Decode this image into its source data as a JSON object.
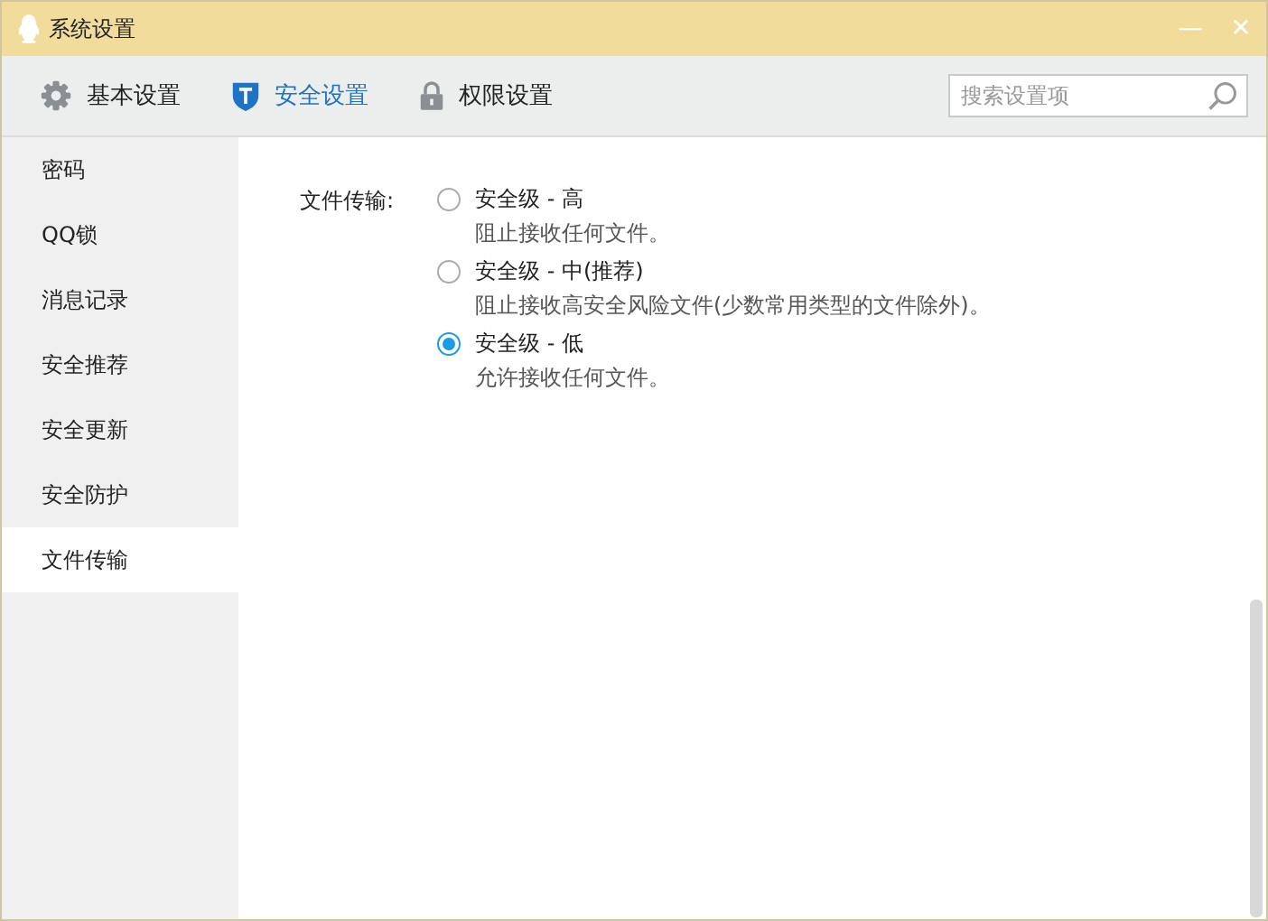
{
  "window": {
    "title": "系统设置",
    "minimize": "—",
    "close": "✕"
  },
  "tabs": [
    {
      "label": "基本设置",
      "selected": false
    },
    {
      "label": "安全设置",
      "selected": true
    },
    {
      "label": "权限设置",
      "selected": false
    }
  ],
  "search": {
    "placeholder": "搜索设置项"
  },
  "sidebar": {
    "items": [
      {
        "label": "密码",
        "selected": false
      },
      {
        "label": "QQ锁",
        "selected": false
      },
      {
        "label": "消息记录",
        "selected": false
      },
      {
        "label": "安全推荐",
        "selected": false
      },
      {
        "label": "安全更新",
        "selected": false
      },
      {
        "label": "安全防护",
        "selected": false
      },
      {
        "label": "文件传输",
        "selected": true
      }
    ]
  },
  "file_transfer": {
    "label": "文件传输:",
    "options": [
      {
        "title": "安全级 - 高",
        "description": "阻止接收任何文件。",
        "selected": false
      },
      {
        "title": "安全级 - 中(推荐)",
        "description": "阻止接收高安全风险文件(少数常用类型的文件除外)。",
        "selected": false
      },
      {
        "title": "安全级 - 低",
        "description": "允许接收任何文件。",
        "selected": true
      }
    ]
  }
}
